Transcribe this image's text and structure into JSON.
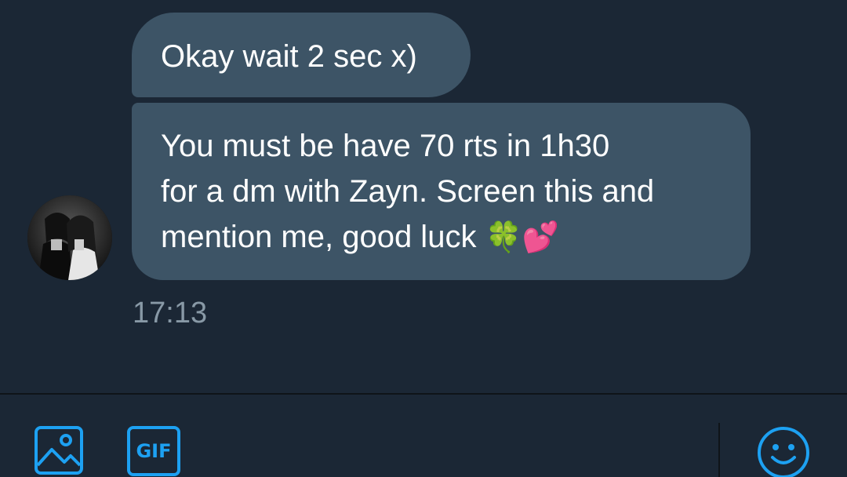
{
  "conversation": {
    "messages": [
      {
        "text": "Okay wait 2 sec x)"
      },
      {
        "lines": [
          "You must be have 70 rts in 1h30",
          "for a dm with Zayn. Screen this and",
          "mention me, good luck"
        ],
        "emojis": "🍀💕"
      }
    ],
    "timestamp": "17:13",
    "sender_avatar": "profile-photo"
  },
  "composer": {
    "icons": {
      "media": "image-icon",
      "gif": "gif-icon",
      "emoji": "smiley-icon"
    },
    "gif_label": "GIF"
  },
  "colors": {
    "background": "#1b2735",
    "bubble": "#3d5466",
    "accent": "#1da1f2",
    "timestamp": "#8899a6"
  }
}
